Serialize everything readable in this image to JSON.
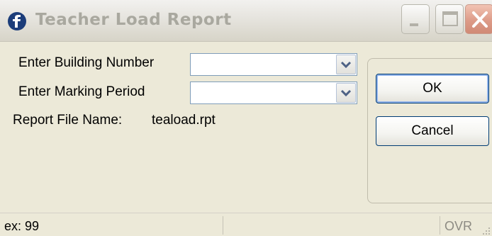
{
  "window": {
    "title": "Teacher Load Report",
    "minimize_icon": "minimize-icon",
    "maximize_icon": "maximize-icon",
    "close_icon": "close-icon",
    "app_icon": "app-logo-icon"
  },
  "form": {
    "building_label": "Enter Building Number",
    "building_value": "",
    "marking_label": "Enter Marking Period",
    "marking_value": "",
    "report_file_label": "Report File Name:",
    "report_file_value": "teaload.rpt"
  },
  "buttons": {
    "ok_label": "OK",
    "cancel_label": "Cancel"
  },
  "statusbar": {
    "hint": "ex: 99",
    "mode": "OVR"
  },
  "colors": {
    "window_bg": "#ece9d8",
    "button_border": "#003c74",
    "close_button": "#dd9b88",
    "title_text": "#a9a89f"
  }
}
